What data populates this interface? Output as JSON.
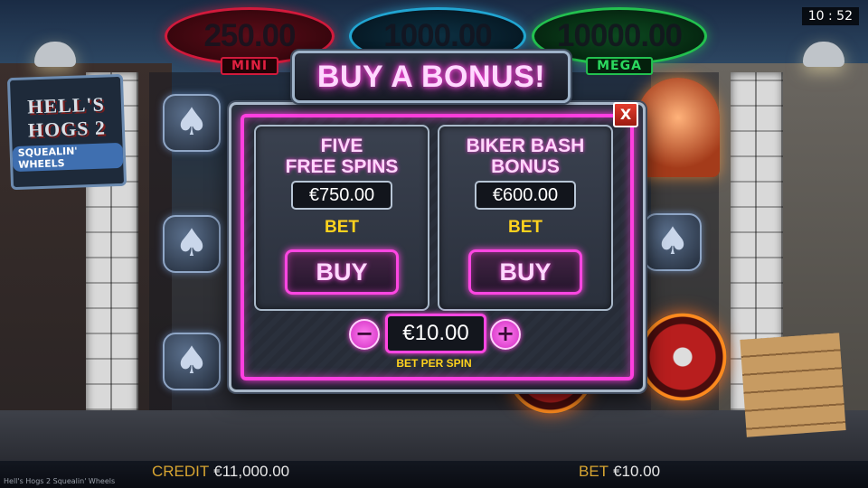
{
  "jackpots": [
    {
      "amount": "250.00",
      "tag": "MINI",
      "color": "#d21a3c"
    },
    {
      "amount": "1000.00",
      "tag": "",
      "color": "#21a5d2"
    },
    {
      "amount": "10000.00",
      "tag": "MEGA",
      "color": "#23c14f"
    }
  ],
  "clock": "10 : 52",
  "logo": {
    "line1": "HELL'S",
    "line2": "HOGS 2",
    "line3": "SQUEALIN' WHEELS"
  },
  "modal": {
    "title": "BUY A BONUS!",
    "close_label": "X",
    "offers": [
      {
        "name_line1": "FIVE",
        "name_line2": "FREE SPINS",
        "price": "€750.00",
        "bet_label": "BET",
        "button_label": "BUY"
      },
      {
        "name_line1": "BIKER BASH",
        "name_line2": "BONUS",
        "price": "€600.00",
        "bet_label": "BET",
        "button_label": "BUY"
      }
    ],
    "stepper": {
      "minus": "−",
      "plus": "+",
      "value": "€10.00",
      "caption": "BET PER SPIN"
    }
  },
  "footer": {
    "credit_label": "CREDIT",
    "credit_value": "€11,000.00",
    "bet_label": "BET",
    "bet_value": "€10.00",
    "game_name": "Hell's Hogs 2 Squealin' Wheels"
  },
  "colors": {
    "accent_pink": "#ff3fe0",
    "gold": "#ffd21e",
    "footer_label": "#d8a531"
  }
}
